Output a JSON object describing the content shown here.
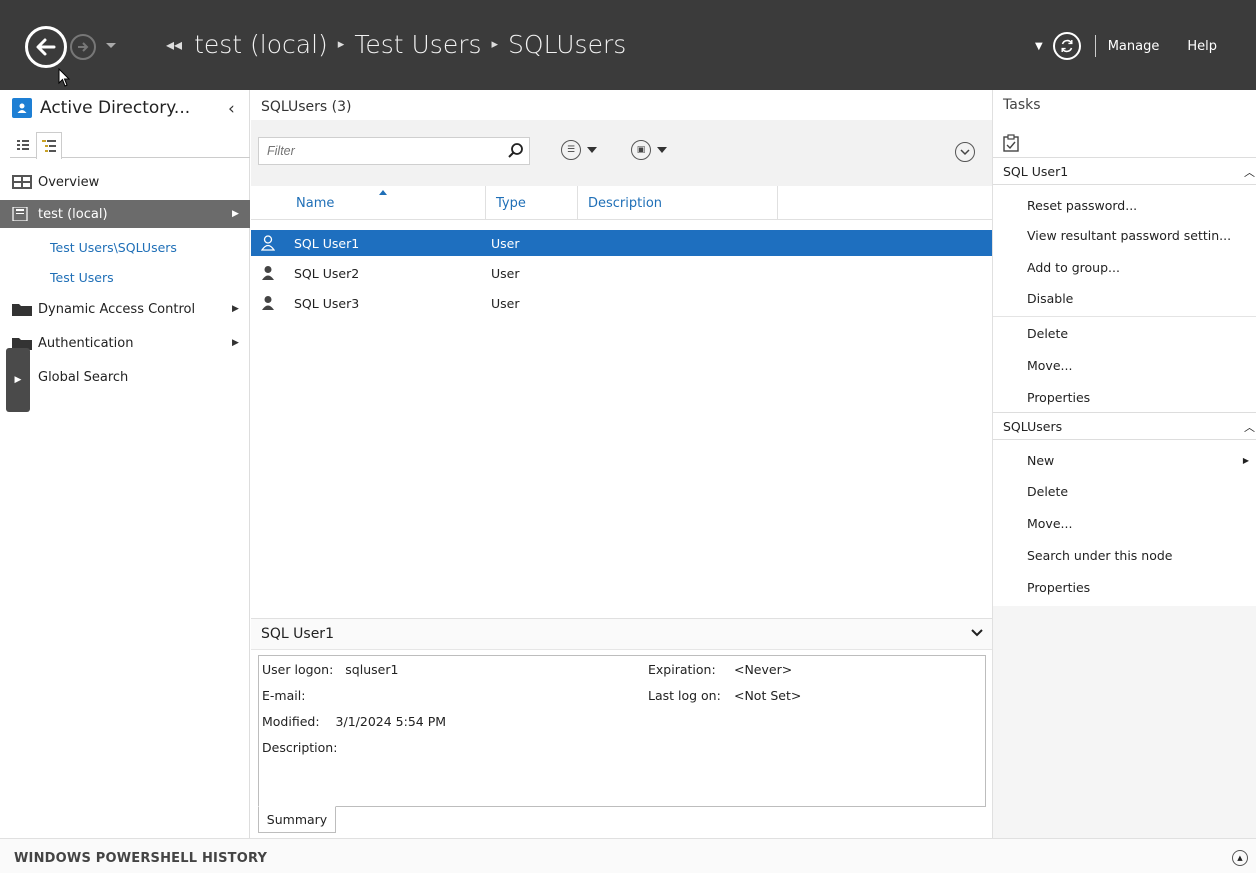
{
  "header": {
    "breadcrumb": [
      "test (local)",
      "Test Users",
      "SQLUsers"
    ],
    "manage": "Manage",
    "help": "Help"
  },
  "nav": {
    "title": "Active Directory...",
    "items": [
      {
        "label": "Overview"
      },
      {
        "label": "test (local)"
      },
      {
        "label": "Test Users\\SQLUsers"
      },
      {
        "label": "Test Users"
      },
      {
        "label": "Dynamic Access Control"
      },
      {
        "label": "Authentication"
      },
      {
        "label": "Global Search"
      }
    ]
  },
  "list": {
    "title": "SQLUsers  (3)",
    "filter_placeholder": "Filter",
    "columns": [
      "Name",
      "Type",
      "Description"
    ],
    "rows": [
      {
        "name": "SQL User1",
        "type": "User"
      },
      {
        "name": "SQL User2",
        "type": "User"
      },
      {
        "name": "SQL User3",
        "type": "User"
      }
    ]
  },
  "details": {
    "title": "SQL User1",
    "user_logon_label": "User logon:",
    "user_logon_value": "sqluser1",
    "email_label": "E-mail:",
    "modified_label": "Modified:",
    "modified_value": "3/1/2024 5:54 PM",
    "description_label": "Description:",
    "expiration_label": "Expiration:",
    "expiration_value": "<Never>",
    "last_logon_label": "Last log on:",
    "last_logon_value": "<Not Set>",
    "summary_tab": "Summary"
  },
  "tasks": {
    "title": "Tasks",
    "group1_title": "SQL User1",
    "group1_items": [
      "Reset password...",
      "View resultant password settin...",
      "Add to group...",
      "Disable",
      "Delete",
      "Move...",
      "Properties"
    ],
    "group2_title": "SQLUsers",
    "group2_items": [
      "New",
      "Delete",
      "Move...",
      "Search under this node",
      "Properties"
    ]
  },
  "footer": {
    "ps_history": "WINDOWS POWERSHELL HISTORY"
  },
  "colors": {
    "topbar": "#3b3b3b",
    "selection": "#1e6fbf",
    "nav_selected": "#6b6b6b",
    "link": "#1f6fb7"
  }
}
